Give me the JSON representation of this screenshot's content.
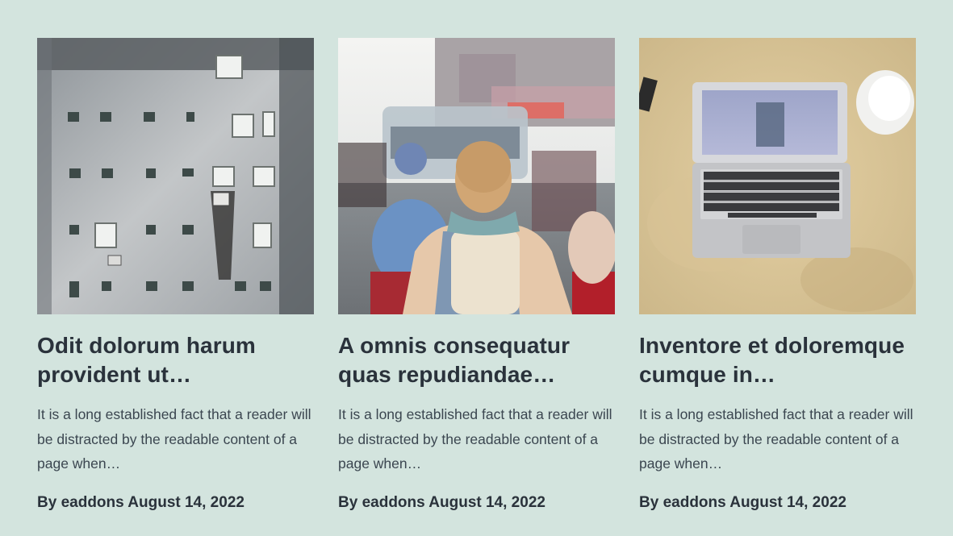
{
  "posts": [
    {
      "title": "Odit dolorum harum provident ut…",
      "excerpt": "It is a long established fact that a reader will be distracted by the readable content of a page when…",
      "by_label": "By",
      "author": "eaddons",
      "date": "August 14, 2022",
      "image": "building-facade-image"
    },
    {
      "title": "A omnis consequatur quas repudiandae…",
      "excerpt": "It is a long established fact that a reader will be distracted by the readable content of a page when…",
      "by_label": "By",
      "author": "eaddons",
      "date": "August 14, 2022",
      "image": "street-traveler-image"
    },
    {
      "title": "Inventore et doloremque cumque in…",
      "excerpt": "It is a long established fact that a reader will be distracted by the readable content of a page when…",
      "by_label": "By",
      "author": "eaddons",
      "date": "August 14, 2022",
      "image": "laptop-desk-image"
    }
  ],
  "colors": {
    "page_background": "#d3e4de",
    "title_text": "#2a323b",
    "body_text": "#3b4650"
  }
}
